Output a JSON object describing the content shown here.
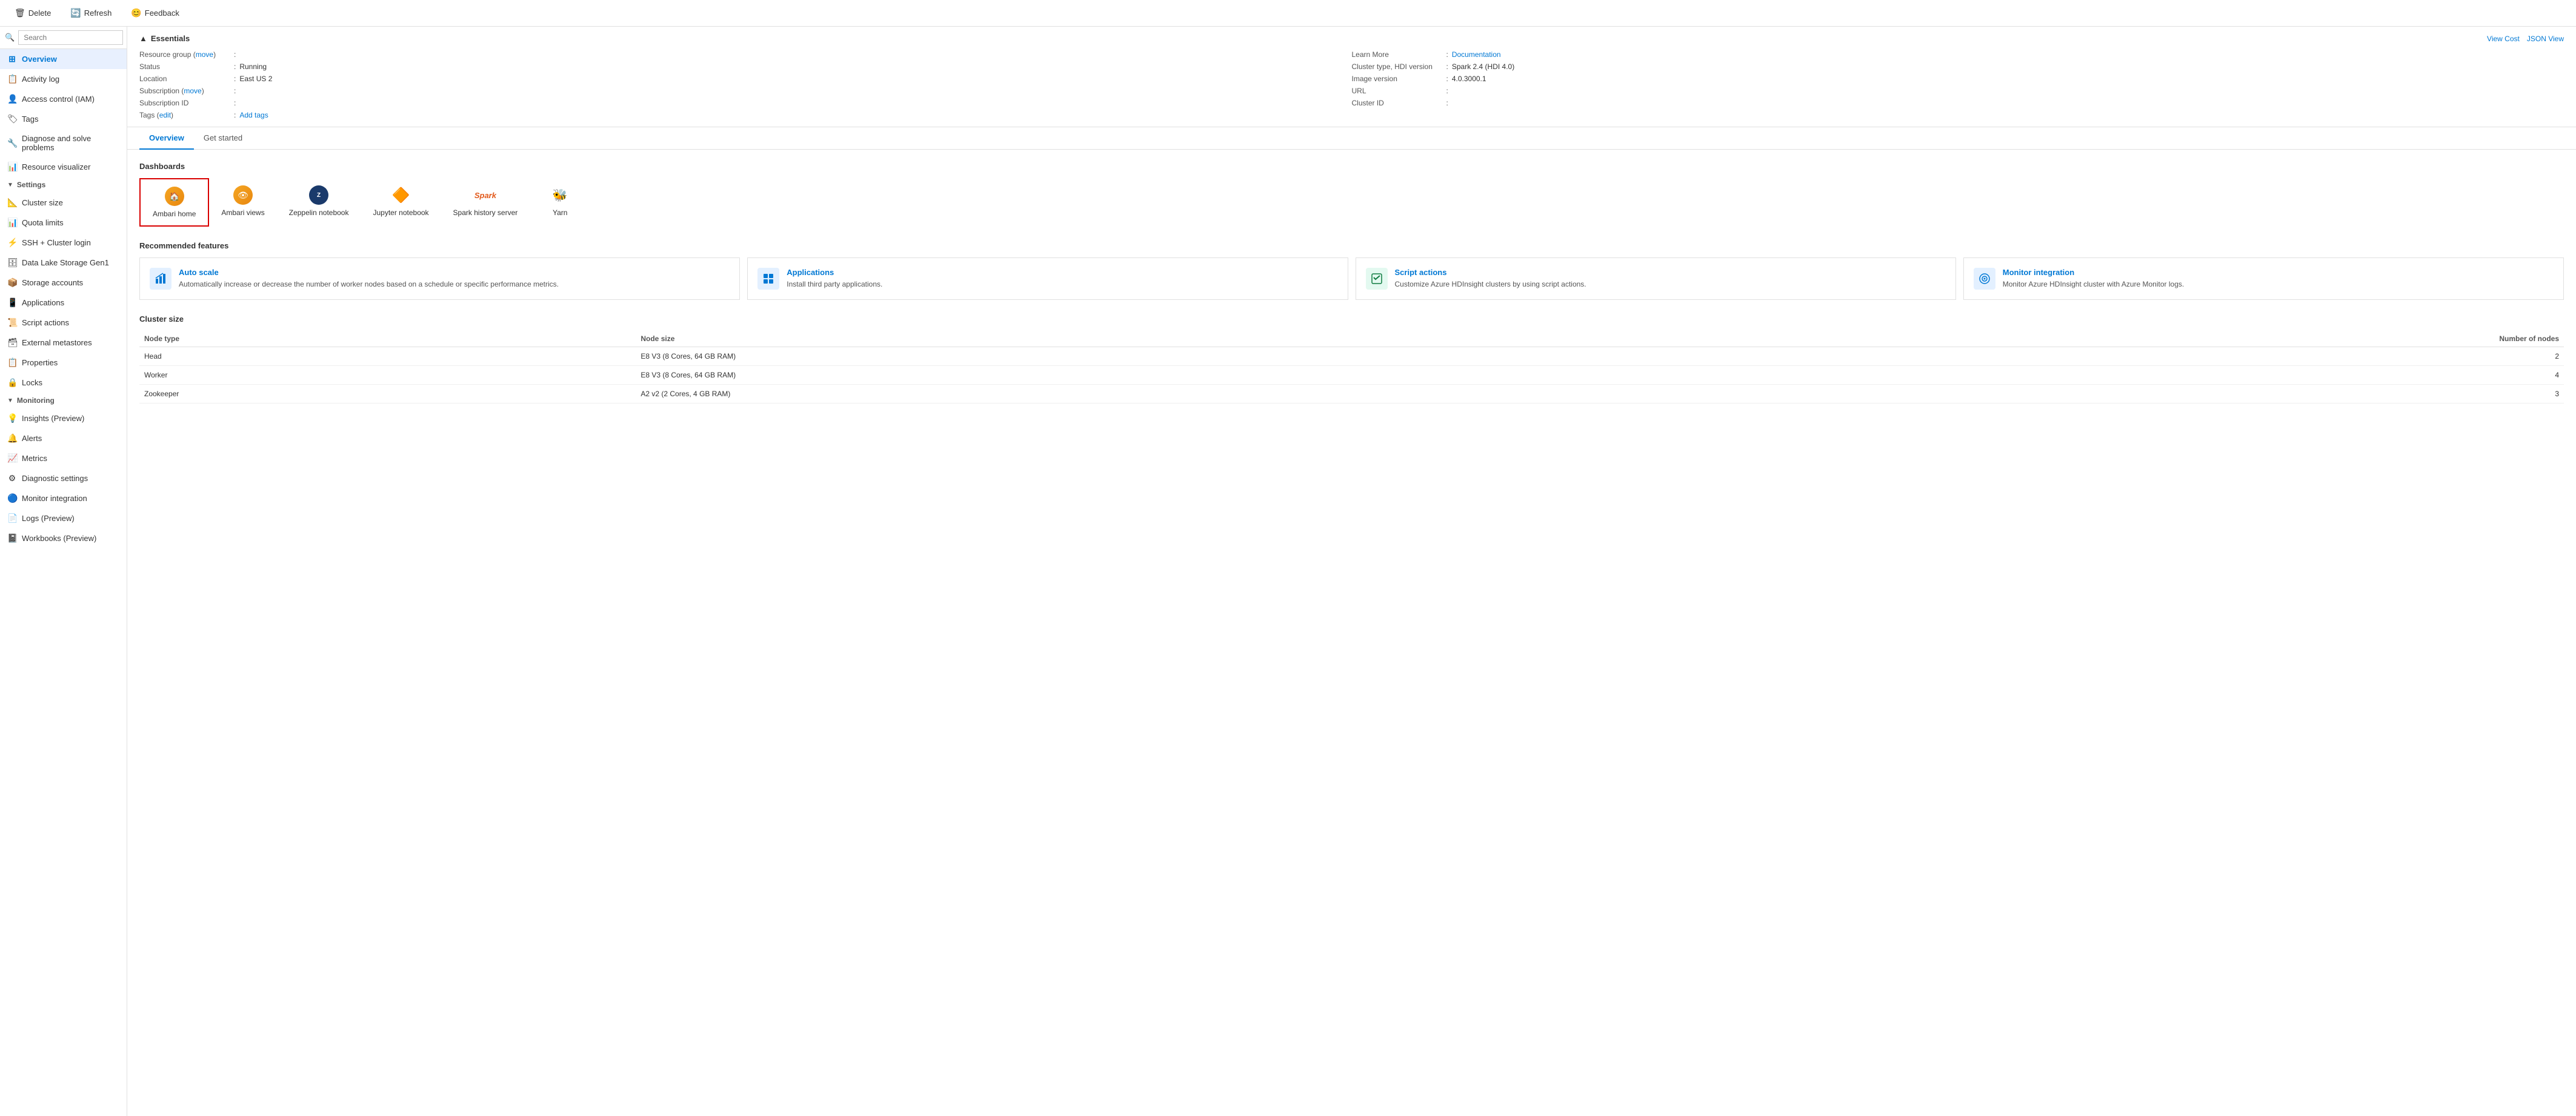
{
  "toolbar": {
    "delete_label": "Delete",
    "refresh_label": "Refresh",
    "feedback_label": "Feedback"
  },
  "sidebar": {
    "search_placeholder": "Search",
    "items": [
      {
        "id": "overview",
        "label": "Overview",
        "icon": "⊞",
        "active": true
      },
      {
        "id": "activity-log",
        "label": "Activity log",
        "icon": "📋"
      },
      {
        "id": "access-control",
        "label": "Access control (IAM)",
        "icon": "👤"
      },
      {
        "id": "tags",
        "label": "Tags",
        "icon": "🏷"
      },
      {
        "id": "diagnose",
        "label": "Diagnose and solve problems",
        "icon": "🔧"
      },
      {
        "id": "resource-visualizer",
        "label": "Resource visualizer",
        "icon": "📊"
      }
    ],
    "sections": [
      {
        "id": "settings",
        "label": "Settings",
        "items": [
          {
            "id": "cluster-size",
            "label": "Cluster size",
            "icon": "📐"
          },
          {
            "id": "quota-limits",
            "label": "Quota limits",
            "icon": "📊"
          },
          {
            "id": "ssh-login",
            "label": "SSH + Cluster login",
            "icon": "⚡"
          },
          {
            "id": "data-lake",
            "label": "Data Lake Storage Gen1",
            "icon": "🗄"
          },
          {
            "id": "storage-accounts",
            "label": "Storage accounts",
            "icon": "📦"
          },
          {
            "id": "applications",
            "label": "Applications",
            "icon": "📱"
          },
          {
            "id": "script-actions",
            "label": "Script actions",
            "icon": "📜"
          },
          {
            "id": "external-metastores",
            "label": "External metastores",
            "icon": "🗃"
          },
          {
            "id": "properties",
            "label": "Properties",
            "icon": "📋"
          },
          {
            "id": "locks",
            "label": "Locks",
            "icon": "🔒"
          }
        ]
      },
      {
        "id": "monitoring",
        "label": "Monitoring",
        "items": [
          {
            "id": "insights",
            "label": "Insights (Preview)",
            "icon": "💡"
          },
          {
            "id": "alerts",
            "label": "Alerts",
            "icon": "🔔"
          },
          {
            "id": "metrics",
            "label": "Metrics",
            "icon": "📈"
          },
          {
            "id": "diagnostic-settings",
            "label": "Diagnostic settings",
            "icon": "⚙"
          },
          {
            "id": "monitor-integration",
            "label": "Monitor integration",
            "icon": "🔵"
          },
          {
            "id": "logs",
            "label": "Logs (Preview)",
            "icon": "📄"
          },
          {
            "id": "workbooks",
            "label": "Workbooks (Preview)",
            "icon": "📓"
          }
        ]
      }
    ]
  },
  "essentials": {
    "title": "Essentials",
    "view_cost_label": "View Cost",
    "json_view_label": "JSON View",
    "left_fields": [
      {
        "label": "Resource group",
        "value": "",
        "link": "move",
        "has_link": true,
        "colon": ":"
      },
      {
        "label": "Status",
        "value": "Running",
        "colon": ":"
      },
      {
        "label": "Location",
        "value": "East US 2",
        "colon": ":"
      },
      {
        "label": "Subscription",
        "value": "",
        "link": "move",
        "has_link": true,
        "colon": ":"
      },
      {
        "label": "Subscription ID",
        "value": "",
        "colon": ":"
      },
      {
        "label": "Tags",
        "value": "",
        "link": "edit",
        "add_link": "Add tags",
        "has_link": true,
        "colon": ":"
      }
    ],
    "right_fields": [
      {
        "label": "Learn More",
        "value": "Documentation",
        "is_link": true,
        "colon": ":"
      },
      {
        "label": "Cluster type, HDI version",
        "value": "Spark 2.4 (HDI 4.0)",
        "colon": ":"
      },
      {
        "label": "Image version",
        "value": "4.0.3000.1",
        "colon": ":"
      },
      {
        "label": "URL",
        "value": "",
        "colon": ":"
      },
      {
        "label": "Cluster ID",
        "value": "",
        "colon": ":"
      }
    ]
  },
  "tabs": [
    {
      "id": "overview",
      "label": "Overview",
      "active": true
    },
    {
      "id": "get-started",
      "label": "Get started",
      "active": false
    }
  ],
  "dashboards": {
    "title": "Dashboards",
    "items": [
      {
        "id": "ambari-home",
        "label": "Ambari home",
        "selected": true
      },
      {
        "id": "ambari-views",
        "label": "Ambari views",
        "selected": false
      },
      {
        "id": "zeppelin-notebook",
        "label": "Zeppelin notebook",
        "selected": false
      },
      {
        "id": "jupyter-notebook",
        "label": "Jupyter notebook",
        "selected": false
      },
      {
        "id": "spark-history",
        "label": "Spark history server",
        "selected": false
      },
      {
        "id": "yarn",
        "label": "Yarn",
        "selected": false
      }
    ]
  },
  "recommended_features": {
    "title": "Recommended features",
    "items": [
      {
        "id": "auto-scale",
        "title": "Auto scale",
        "description": "Automatically increase or decrease the number of worker nodes based on a schedule or specific performance metrics."
      },
      {
        "id": "applications",
        "title": "Applications",
        "description": "Install third party applications."
      },
      {
        "id": "script-actions",
        "title": "Script actions",
        "description": "Customize Azure HDInsight clusters by using script actions."
      },
      {
        "id": "monitor-integration",
        "title": "Monitor integration",
        "description": "Monitor Azure HDInsight cluster with Azure Monitor logs."
      }
    ]
  },
  "cluster_size": {
    "title": "Cluster size",
    "columns": [
      "Node type",
      "Node size",
      "Number of nodes"
    ],
    "rows": [
      {
        "node_type": "Head",
        "node_size": "E8 V3 (8 Cores, 64 GB RAM)",
        "num_nodes": "2"
      },
      {
        "node_type": "Worker",
        "node_size": "E8 V3 (8 Cores, 64 GB RAM)",
        "num_nodes": "4"
      },
      {
        "node_type": "Zookeeper",
        "node_size": "A2 v2 (2 Cores, 4 GB RAM)",
        "num_nodes": "3"
      }
    ]
  }
}
